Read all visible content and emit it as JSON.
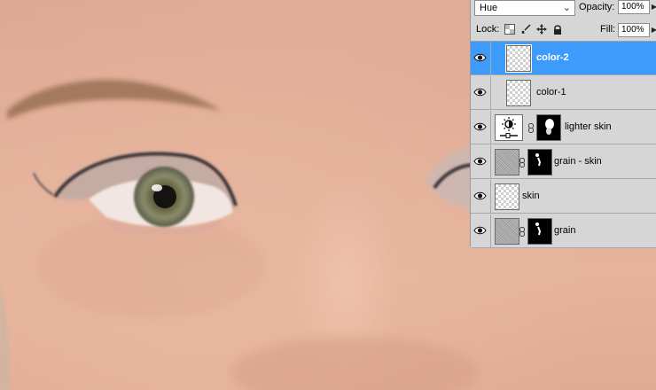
{
  "options_bar": {
    "blend_mode": "Hue",
    "opacity_label": "Opacity:",
    "opacity_value": "100%",
    "lock_label": "Lock:",
    "fill_label": "Fill:",
    "fill_value": "100%"
  },
  "layers": [
    {
      "name": "color-2",
      "visible": true,
      "selected": true,
      "thumb": "transparent"
    },
    {
      "name": "color-1",
      "visible": true,
      "selected": false,
      "thumb": "transparent"
    },
    {
      "name": "lighter skin",
      "visible": true,
      "selected": false,
      "thumb": "adjustment",
      "mask": true
    },
    {
      "name": "grain - skin",
      "visible": true,
      "selected": false,
      "thumb": "noise",
      "mask": true
    },
    {
      "name": "skin",
      "visible": true,
      "selected": false,
      "thumb": "transparent"
    },
    {
      "name": "grain",
      "visible": true,
      "selected": false,
      "thumb": "noise",
      "mask": true
    }
  ],
  "colors": {
    "selection": "#3d9bfc",
    "panel": "#d6d6d6",
    "skin": "#e4b09b"
  },
  "icons": [
    "eye-icon",
    "lock-transparent-icon",
    "lock-brush-icon",
    "lock-move-icon",
    "lock-all-icon",
    "chain-link-icon",
    "chevron-down-icon",
    "arrow-right-icon",
    "brightness-adjustment-icon"
  ]
}
